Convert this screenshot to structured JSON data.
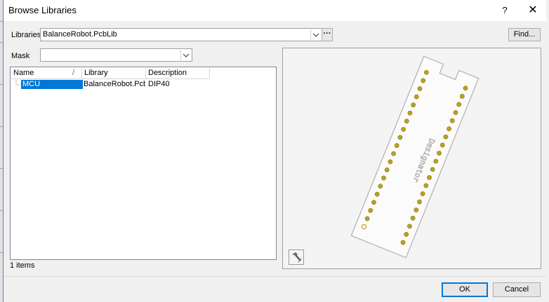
{
  "dialog": {
    "title": "Browse Libraries",
    "help": "?",
    "close": "✕"
  },
  "libraries": {
    "label": "Libraries",
    "value": "BalanceRobot.PcbLib",
    "more": "···",
    "find_label": "Find..."
  },
  "mask": {
    "label": "Mask",
    "value": ""
  },
  "table": {
    "columns": [
      "Name",
      "Library",
      "Description"
    ],
    "sort_indicator": "/",
    "rows": [
      {
        "name": "MCU",
        "library": "BalanceRobot.PcbL",
        "description": "DIP40"
      }
    ]
  },
  "status": {
    "count": "1 items"
  },
  "preview": {
    "designator": "Designator",
    "pin_count_per_side": 20,
    "pad_color": "#b8a220"
  },
  "buttons": {
    "ok": "OK",
    "cancel": "Cancel"
  }
}
